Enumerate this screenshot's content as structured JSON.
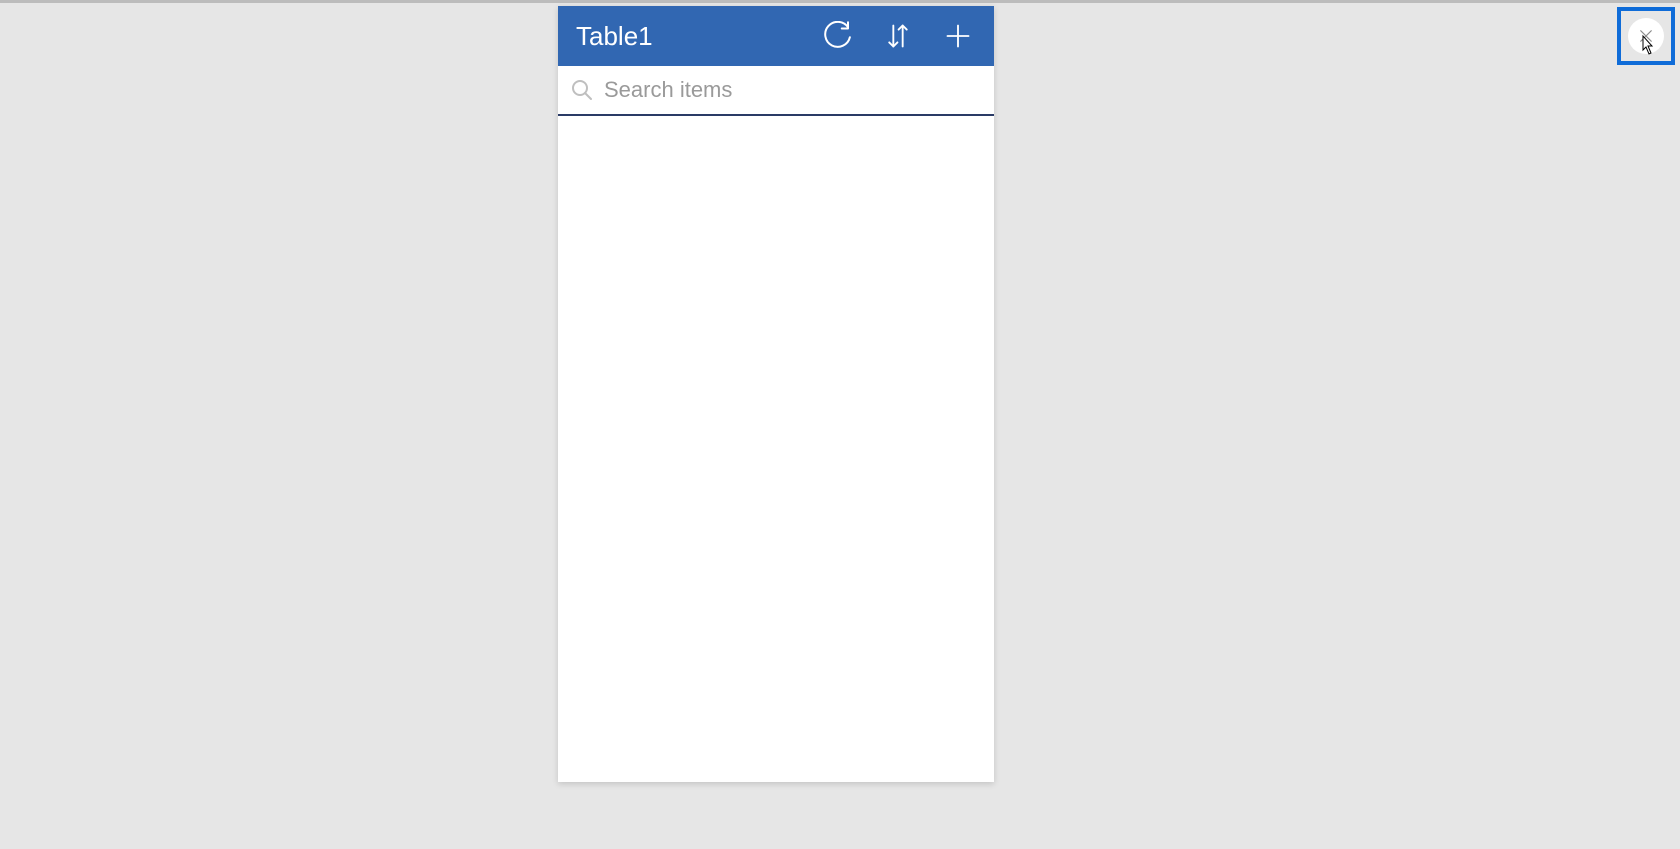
{
  "panel": {
    "title": "Table1",
    "actions": {
      "refresh": "refresh",
      "sort": "sort",
      "add": "add"
    }
  },
  "search": {
    "placeholder": "Search items",
    "value": ""
  },
  "close": {
    "label": "close"
  },
  "colors": {
    "header_bg": "#3167b2",
    "accent_border": "#0f6cd8"
  }
}
